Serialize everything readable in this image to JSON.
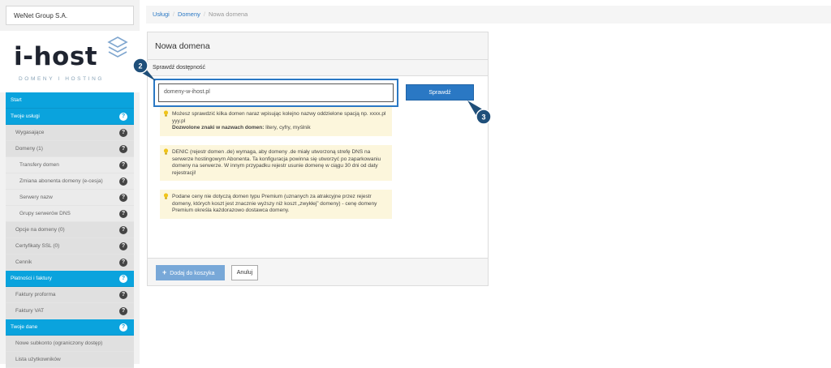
{
  "company": "WeNet Group S.A.",
  "logo": {
    "name": "i-host",
    "tagline": "DOMENY I HOSTING"
  },
  "menu": [
    {
      "label": "Start",
      "level": "primary",
      "help": false
    },
    {
      "label": "Twoje usługi",
      "level": "primary",
      "help": true
    },
    {
      "label": "Wygasające",
      "level": "sub",
      "help": true
    },
    {
      "label": "Domeny (1)",
      "level": "sub",
      "help": true
    },
    {
      "label": "Transfery domen",
      "level": "sub2",
      "help": true
    },
    {
      "label": "Zmiana abonenta domeny (e-cesja)",
      "level": "sub2",
      "help": true
    },
    {
      "label": "Serwery nazw",
      "level": "sub2",
      "help": true
    },
    {
      "label": "Grupy serwerów DNS",
      "level": "sub2",
      "help": true
    },
    {
      "label": "Opcje na domeny (0)",
      "level": "sub",
      "help": true
    },
    {
      "label": "Certyfikaty SSL (0)",
      "level": "sub",
      "help": true
    },
    {
      "label": "Cennik",
      "level": "sub",
      "help": true
    },
    {
      "label": "Płatności i faktury",
      "level": "primary",
      "help": true
    },
    {
      "label": "Faktury proforma",
      "level": "sub",
      "help": true
    },
    {
      "label": "Faktury VAT",
      "level": "sub",
      "help": true
    },
    {
      "label": "Twoje dane",
      "level": "primary",
      "help": true
    },
    {
      "label": "Nowe subkonto (ograniczony dostęp)",
      "level": "sub",
      "help": false
    },
    {
      "label": "Lista użytkowników",
      "level": "sub",
      "help": false
    }
  ],
  "help_glyph": "?",
  "breadcrumb": {
    "item1": "Usługi",
    "item2": "Domeny",
    "current": "Nowa domena",
    "sep": "/"
  },
  "panel": {
    "title": "Nowa domena",
    "subtitle": "Sprawdź dostępność",
    "input_value": "domeny-w-ihost.pl",
    "check_button": "Sprawdź",
    "hint1_text": "Możesz sprawdzić kilka domen naraz wpisując kolejno nazwy oddzielone spacją np. xxxx.pl yyy.pl",
    "hint1_bold": "Dozwolone znaki w nazwach domen:",
    "hint1_tail": " litery, cyfry, myślnik",
    "hint2": "DENIC (rejestr domen .de) wymaga, aby domeny .de miały utworzoną strefę DNS na serwerze hostingowym Abonenta. Ta konfiguracja powinna się utworzyć po zaparkowaniu domeny na serwerze. W innym przypadku rejestr usunie domenę w ciągu 30 dni od daty rejestracji!",
    "hint3": "Podane ceny nie dotyczą domen typu Premium (uznanych za atrakcyjne przez rejestr domeny, których koszt jest znacznie wyższy niż koszt „zwykłej” domeny) - cenę domeny Premium określa każdorazowo dostawca domeny.",
    "add_button": "Dodaj do koszyka",
    "add_icon": "+",
    "cancel_button": "Anuluj"
  },
  "badges": {
    "step2": "2",
    "step3": "3"
  },
  "colors": {
    "accent": "#0aa3dd",
    "button": "#2a78c4",
    "hint_bg": "#fcf6dc"
  }
}
